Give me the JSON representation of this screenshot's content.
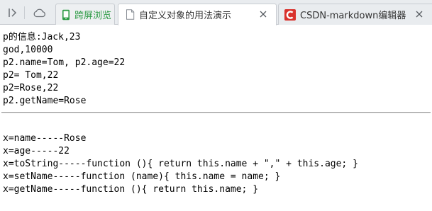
{
  "browser": {
    "tabs": [
      {
        "label": "跨屏浏览",
        "state": "pinned",
        "icon": "phone-icon",
        "color": "#2e9b46"
      },
      {
        "label": "自定义对象的用法演示",
        "state": "active",
        "icon": "page-icon"
      },
      {
        "label": "CSDN-markdown编辑器",
        "state": "inactive",
        "icon": "csdn-logo-icon",
        "color": "#d9312c"
      }
    ]
  },
  "page": {
    "lines_before_rule": [
      "p的信息:Jack,23",
      "god,10000",
      "p2.name=Tom, p2.age=22",
      "p2= Tom,22",
      "p2=Rose,22",
      "p2.getName=Rose"
    ],
    "lines_after_rule": [
      "x=name-----Rose",
      "x=age-----22",
      "x=toString-----function (){ return this.name + \",\" + this.age; }",
      "x=setName-----function (name){ this.name = name; }",
      "x=getName-----function (){ return this.name; }"
    ]
  }
}
